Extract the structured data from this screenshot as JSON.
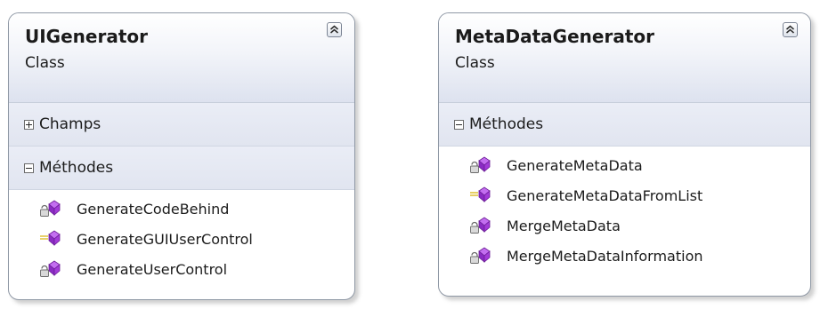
{
  "classes": [
    {
      "name": "UIGenerator",
      "kind": "Class",
      "collapse_icon": "double-chevron-up-icon",
      "compartments": [
        {
          "label": "Champs",
          "expanded": false,
          "members": []
        },
        {
          "label": "Méthodes",
          "expanded": true,
          "members": [
            {
              "name": "GenerateCodeBehind",
              "visibility": "private",
              "icon": "private-method-icon"
            },
            {
              "name": "GenerateGUIUserControl",
              "visibility": "internal",
              "icon": "internal-method-icon"
            },
            {
              "name": "GenerateUserControl",
              "visibility": "private",
              "icon": "private-method-icon"
            }
          ]
        }
      ]
    },
    {
      "name": "MetaDataGenerator",
      "kind": "Class",
      "collapse_icon": "double-chevron-up-icon",
      "compartments": [
        {
          "label": "Méthodes",
          "expanded": true,
          "members": [
            {
              "name": "GenerateMetaData",
              "visibility": "private",
              "icon": "private-method-icon"
            },
            {
              "name": "GenerateMetaDataFromList",
              "visibility": "internal",
              "icon": "internal-method-icon"
            },
            {
              "name": "MergeMetaData",
              "visibility": "private",
              "icon": "private-method-icon"
            },
            {
              "name": "MergeMetaDataInformation",
              "visibility": "private",
              "icon": "private-method-icon"
            }
          ]
        }
      ]
    }
  ],
  "colors": {
    "method_purple": "#a23bd8",
    "header_gradient_bottom": "#dde2ef",
    "border": "#8f98a5"
  }
}
